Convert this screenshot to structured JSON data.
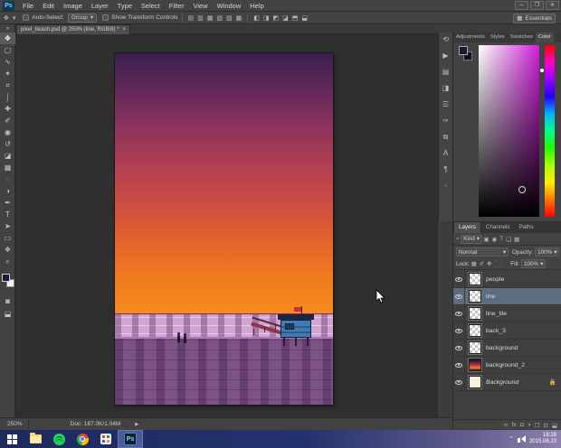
{
  "app": {
    "logo": "Ps",
    "window_controls": [
      {
        "name": "minimize",
        "glyph": "–"
      },
      {
        "name": "restore",
        "glyph": "❐"
      },
      {
        "name": "close",
        "glyph": "✕"
      }
    ]
  },
  "menubar": {
    "items": [
      "File",
      "Edit",
      "Image",
      "Layer",
      "Type",
      "Select",
      "Filter",
      "View",
      "Window",
      "Help"
    ]
  },
  "options_bar": {
    "tool_icon_glyph": "✥",
    "caret": "▾",
    "auto_select_label": "Auto-Select:",
    "auto_select_value": "Group",
    "show_transform_label": "Show Transform Controls",
    "align_icons": [
      {
        "name": "align-left",
        "glyph": "▤"
      },
      {
        "name": "align-center-h",
        "glyph": "▥"
      },
      {
        "name": "align-right",
        "glyph": "▦"
      },
      {
        "name": "align-top",
        "glyph": "▧"
      },
      {
        "name": "align-middle",
        "glyph": "▨"
      },
      {
        "name": "align-bottom",
        "glyph": "▩"
      },
      {
        "name": "distribute-top",
        "glyph": "◧"
      },
      {
        "name": "distribute-middle",
        "glyph": "◨"
      },
      {
        "name": "distribute-bottom",
        "glyph": "◩"
      },
      {
        "name": "distribute-left",
        "glyph": "◪"
      },
      {
        "name": "distribute-center",
        "glyph": "⬒"
      },
      {
        "name": "distribute-right",
        "glyph": "⬓"
      }
    ],
    "workspace_label": "Essentials",
    "workspace_icon": "▦"
  },
  "document_tab": {
    "title": "pixel_beach.psd @ 250% (line, RGB/8) *",
    "close_glyph": "×"
  },
  "toolbar": {
    "collapse_glyph": "»",
    "tools": [
      {
        "name": "move",
        "glyph": "✥"
      },
      {
        "name": "rectangular-marquee",
        "glyph": "▢"
      },
      {
        "name": "lasso",
        "glyph": "∿"
      },
      {
        "name": "quick-selection",
        "glyph": "✶"
      },
      {
        "name": "crop",
        "glyph": "⌗"
      },
      {
        "name": "eyedropper",
        "glyph": "⌡"
      },
      {
        "name": "spot-healing",
        "glyph": "✚"
      },
      {
        "name": "brush",
        "glyph": "✐"
      },
      {
        "name": "clone-stamp",
        "glyph": "◉"
      },
      {
        "name": "history-brush",
        "glyph": "↺"
      },
      {
        "name": "eraser",
        "glyph": "◪"
      },
      {
        "name": "gradient",
        "glyph": "▦"
      },
      {
        "name": "blur",
        "glyph": "◌"
      },
      {
        "name": "dodge",
        "glyph": "◑"
      },
      {
        "name": "pen",
        "glyph": "✒"
      },
      {
        "name": "type",
        "glyph": "T"
      },
      {
        "name": "path-selection",
        "glyph": "➤"
      },
      {
        "name": "rectangle-shape",
        "glyph": "▭"
      },
      {
        "name": "hand",
        "glyph": "❖"
      },
      {
        "name": "zoom",
        "glyph": "⌕"
      }
    ],
    "fg_color": "#251634",
    "bg_color": "#f2f2f2",
    "quick_mask_glyph": "◙",
    "screen_mode_glyph": "⬓"
  },
  "dock_strip": {
    "icons": [
      {
        "name": "history",
        "glyph": "⟲"
      },
      {
        "name": "actions",
        "glyph": "▶"
      },
      {
        "name": "styles",
        "glyph": "▤"
      },
      {
        "name": "info",
        "glyph": "◨"
      },
      {
        "name": "histogram",
        "glyph": "☰"
      },
      {
        "name": "brush-presets",
        "glyph": "✑"
      },
      {
        "name": "clone-source",
        "glyph": "⧉"
      },
      {
        "name": "character",
        "glyph": "A"
      },
      {
        "name": "paragraph",
        "glyph": "¶"
      },
      {
        "name": "notes",
        "glyph": "▪"
      }
    ]
  },
  "color_panel": {
    "tabs": [
      "Adjustments",
      "Styles",
      "Swatches",
      "Color"
    ],
    "active_tab": "Color",
    "foreground_color": "#251634",
    "background_color": "#171024",
    "hue_colors": [
      "#ff0000",
      "#ff00c8",
      "#9900ff",
      "#2200ff",
      "#00b4ff",
      "#00ff88",
      "#22ff00",
      "#aaff00",
      "#ffee00",
      "#ff7700",
      "#ff0000"
    ],
    "picker_base_hue": "#d01fd9"
  },
  "layers_panel": {
    "tabs": [
      "Layers",
      "Channels",
      "Paths"
    ],
    "active_tab": "Layers",
    "filter_icon": "⌕",
    "filter_label": "Kind",
    "filter_icons": [
      {
        "name": "filter-image",
        "glyph": "▣"
      },
      {
        "name": "filter-adjustment",
        "glyph": "◉"
      },
      {
        "name": "filter-type",
        "glyph": "T"
      },
      {
        "name": "filter-shape",
        "glyph": "❏"
      },
      {
        "name": "filter-smart-object",
        "glyph": "▦"
      }
    ],
    "blend_mode": "Normal",
    "opacity_label": "Opacity:",
    "opacity_value": "100%",
    "lock_label": "Lock:",
    "lock_icons": [
      {
        "name": "lock-transparency",
        "glyph": "▦"
      },
      {
        "name": "lock-pixels",
        "glyph": "✐"
      },
      {
        "name": "lock-position",
        "glyph": "✥"
      },
      {
        "name": "lock-all",
        "glyph": "⬛"
      }
    ],
    "fill_label": "Fill:",
    "fill_value": "100%",
    "items": [
      {
        "name": "people"
      },
      {
        "name": "line",
        "selected": true
      },
      {
        "name": "line_tile"
      },
      {
        "name": "back_3"
      },
      {
        "name": "background"
      },
      {
        "name": "background_2",
        "thumb": "sunset"
      },
      {
        "name": "Background",
        "locked": true,
        "thumb": "plain"
      }
    ],
    "lock_badge_glyph": "🔒",
    "bottom_icons": [
      {
        "name": "link-layers",
        "glyph": "∞"
      },
      {
        "name": "layer-effects",
        "glyph": "fx"
      },
      {
        "name": "add-layer-mask",
        "glyph": "◘"
      },
      {
        "name": "new-adjustment-layer",
        "glyph": "◑"
      },
      {
        "name": "new-group",
        "glyph": "❐"
      },
      {
        "name": "new-layer",
        "glyph": "⊡"
      },
      {
        "name": "delete-layer",
        "glyph": "⬓"
      }
    ]
  },
  "status_bar": {
    "zoom": "250%",
    "doc_info": "Doc: 187.0K/1.04M",
    "flyout_glyph": "▶"
  },
  "canvas": {
    "sky_stops": [
      "#3a1f4e",
      "#62295a",
      "#8f335c",
      "#b03f52",
      "#cc4c42",
      "#e2622f",
      "#ef7a1f",
      "#f68c1e"
    ],
    "sea_color": "#cfa6d2",
    "beach_color": "#7d5386",
    "tower_cabin_color": "#3e7cb1",
    "flag_color": "#cf2b3a"
  },
  "taskbar": {
    "apps": [
      "start",
      "file-explorer",
      "spotify",
      "chrome",
      "grid-app",
      "photoshop"
    ],
    "ps_label": "Ps",
    "tray_chevron": "⌃",
    "clock_time": "19:28",
    "clock_date": "2015.06.23"
  }
}
